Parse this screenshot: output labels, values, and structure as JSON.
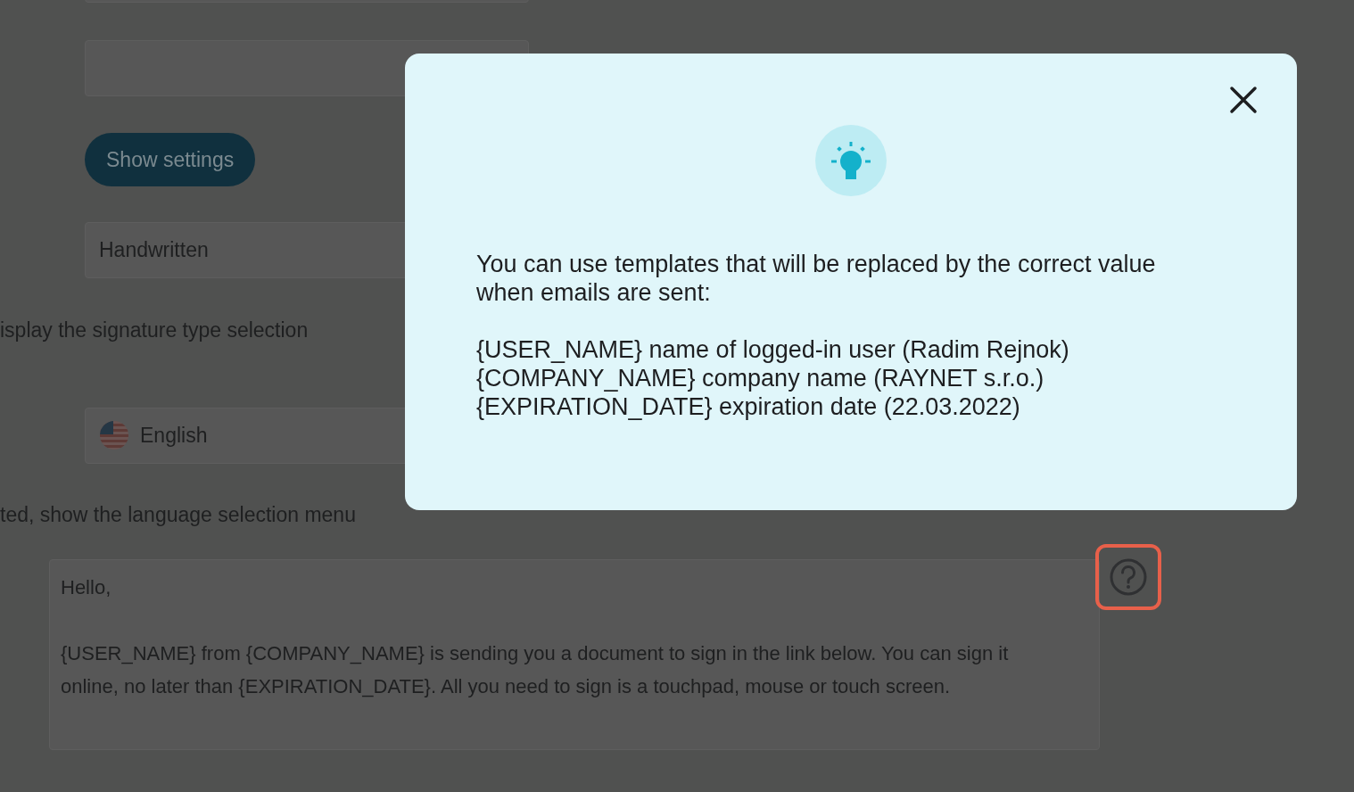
{
  "page": {
    "fields": [
      {
        "kind": "input"
      },
      {
        "kind": "input"
      },
      {
        "kind": "button",
        "label": "Show settings"
      },
      {
        "kind": "input",
        "value": "Handwritten"
      },
      {
        "kind": "note",
        "text": "isplay the signature type selection"
      },
      {
        "kind": "language",
        "value": "English"
      },
      {
        "kind": "note",
        "text": "ted, show the language selection menu"
      }
    ],
    "message": {
      "value": "Hello,\n\n{USER_NAME} from {COMPANY_NAME} is sending you a document to sign in the link below. You can sign it online, no later than {EXPIRATION_DATE}. All you need to sign is a touchpad, mouse or touch screen.",
      "help_highlighted": true
    }
  },
  "modal": {
    "intro": "You can use templates that will be replaced by the correct value when emails are sent:",
    "lines": [
      "{USER_NAME} name of logged-in user (Radim Rejnok)",
      "{COMPANY_NAME} company name (RAYNET s.r.o.)",
      "{EXPIRATION_DATE} expiration date (22.03.2022)"
    ]
  }
}
